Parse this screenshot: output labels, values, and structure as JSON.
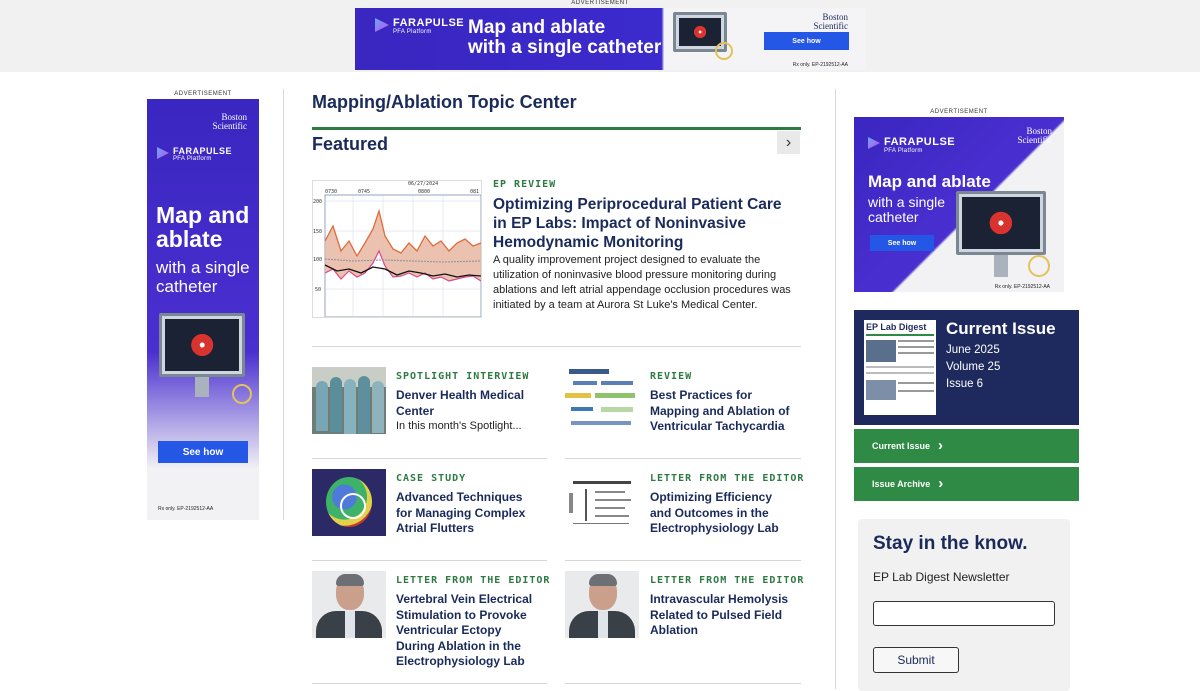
{
  "top_ad": {
    "label": "ADVERTISEMENT",
    "brand": "FARAPULSE",
    "brand_sub": "PFA Platform",
    "headline_1": "Map and ablate",
    "headline_2": "with a single catheter",
    "button": "See how",
    "maker_1": "Boston",
    "maker_2": "Scientific",
    "rx": "Rx only.  EP-2192512-AA"
  },
  "left_ad": {
    "label": "ADVERTISEMENT",
    "maker_1": "Boston",
    "maker_2": "Scientific",
    "brand": "FARAPULSE",
    "brand_sub": "PFA Platform",
    "headline_1": "Map and",
    "headline_2": "ablate",
    "sub_1": "with a single",
    "sub_2": "catheter",
    "button": "See how",
    "rx": "Rx only.  EP-2192512-AA"
  },
  "right_ad": {
    "label": "ADVERTISEMENT",
    "maker_1": "Boston",
    "maker_2": "Scientific",
    "brand": "FARAPULSE",
    "brand_sub": "PFA Platform",
    "headline_1": "Map and ablate",
    "sub_1": "with a single",
    "sub_2": "catheter",
    "button": "See how",
    "rx": "Rx only.  EP-2192512-AA"
  },
  "page_title": "Mapping/Ablation Topic Center",
  "featured": {
    "heading": "Featured",
    "next_icon": "chevron-right-icon",
    "hero": {
      "category": "EP REVIEW",
      "title": "Optimizing Periprocedural Patient Care in EP Labs: Impact of Noninvasive Hemodynamic Monitoring",
      "description": "A quality improvement project designed to evaluate the utilization of noninvasive blood pressure monitoring during ablations and left atrial appendage occlusion procedures was initiated by a team at Aurora St Luke's Medical Center.",
      "chart_date": "06/27/2024",
      "chart_times": [
        "0730",
        "0745",
        "0800",
        "081"
      ],
      "chart_yticks": [
        "200",
        "150",
        "100",
        "50"
      ]
    }
  },
  "cards": [
    {
      "category": "SPOTLIGHT INTERVIEW",
      "title": "Denver Health Medical Center",
      "description": "In this month's Spotlight..."
    },
    {
      "category": "REVIEW",
      "title": "Best Practices for Mapping and Ablation of Ventricular Tachycardia",
      "description": ""
    },
    {
      "category": "CASE STUDY",
      "title": "Advanced Techniques for Managing Complex Atrial Flutters",
      "description": ""
    },
    {
      "category": "LETTER FROM THE EDITOR",
      "title": "Optimizing Efficiency and Outcomes in the Electrophysiology Lab",
      "description": ""
    },
    {
      "category": "LETTER FROM THE EDITOR",
      "title": "Vertebral Vein Electrical Stimulation to Provoke Ventricular Ectopy During Ablation in the Electrophysiology Lab",
      "description": ""
    },
    {
      "category": "LETTER FROM THE EDITOR",
      "title": "Intravascular Hemolysis Related to Pulsed Field Ablation",
      "description": ""
    }
  ],
  "current_issue": {
    "heading": "Current Issue",
    "date": "June 2025",
    "volume": "Volume 25",
    "issue": "Issue 6",
    "cover_title": "EP Lab Digest",
    "current_btn": "Current Issue",
    "archive_btn": "Issue Archive"
  },
  "newsletter": {
    "heading": "Stay in the know.",
    "subheading": "EP Lab Digest Newsletter",
    "email_value": "",
    "submit": "Submit"
  },
  "colors": {
    "navy": "#1e2a5e",
    "green": "#2e8a45",
    "ad_purple": "#3a26c0",
    "ad_blue_btn": "#2457e6"
  }
}
